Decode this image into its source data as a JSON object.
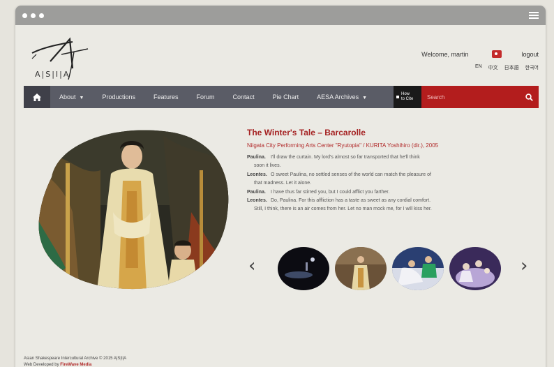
{
  "site": {
    "logo_text": "A|S|I|A"
  },
  "header": {
    "welcome": "Welcome, martin",
    "logout": "logout",
    "languages": [
      "EN",
      "中文",
      "日本語",
      "한국어"
    ]
  },
  "nav": {
    "items": [
      {
        "label": "About",
        "dropdown": true
      },
      {
        "label": "Productions",
        "dropdown": false
      },
      {
        "label": "Features",
        "dropdown": false
      },
      {
        "label": "Forum",
        "dropdown": false
      },
      {
        "label": "Contact",
        "dropdown": false
      },
      {
        "label": "Pie Chart",
        "dropdown": false
      },
      {
        "label": "AESA Archives",
        "dropdown": true
      }
    ],
    "how_to_cite_line1": "How",
    "how_to_cite_line2": "to Cite",
    "search_placeholder": "Search"
  },
  "featured": {
    "title": "The Winter's Tale – Barcarolle",
    "subtitle": "Niigata City Performing Arts Center \"Ryutopia\" / KURITA Yoshihiro (dir.), 2005",
    "lines": [
      {
        "speaker": "Paulina.",
        "text": "I'll draw the curtain. My lord's almost so far transported that he'll think",
        "cont": "soon it lives."
      },
      {
        "speaker": "Leontes.",
        "text": "O sweet Paulina, no settled senses of the world can match the pleasure of",
        "cont": "that madness. Let it alone."
      },
      {
        "speaker": "Paulina.",
        "text": "I have thus far stirred you, but I could afflict you farther.",
        "cont": ""
      },
      {
        "speaker": "Leontes.",
        "text": "Do, Paulina. For this affliction has a taste as sweet as any cordial comfort.",
        "cont": "Still, I think, there is an air comes from her. Let no man mock me, for I will kiss her."
      }
    ]
  },
  "carousel": {
    "prev_glyph": "‹",
    "next_glyph": "›"
  },
  "footer": {
    "copyright": "Asian Shakespeare Intercultural Archive © 2015 A|S|I|A",
    "developed_prefix": "Web Developed by ",
    "developer": "FireWave Media"
  },
  "colors": {
    "accent_red": "#b31d1d",
    "nav_gray": "#5a5c66"
  }
}
